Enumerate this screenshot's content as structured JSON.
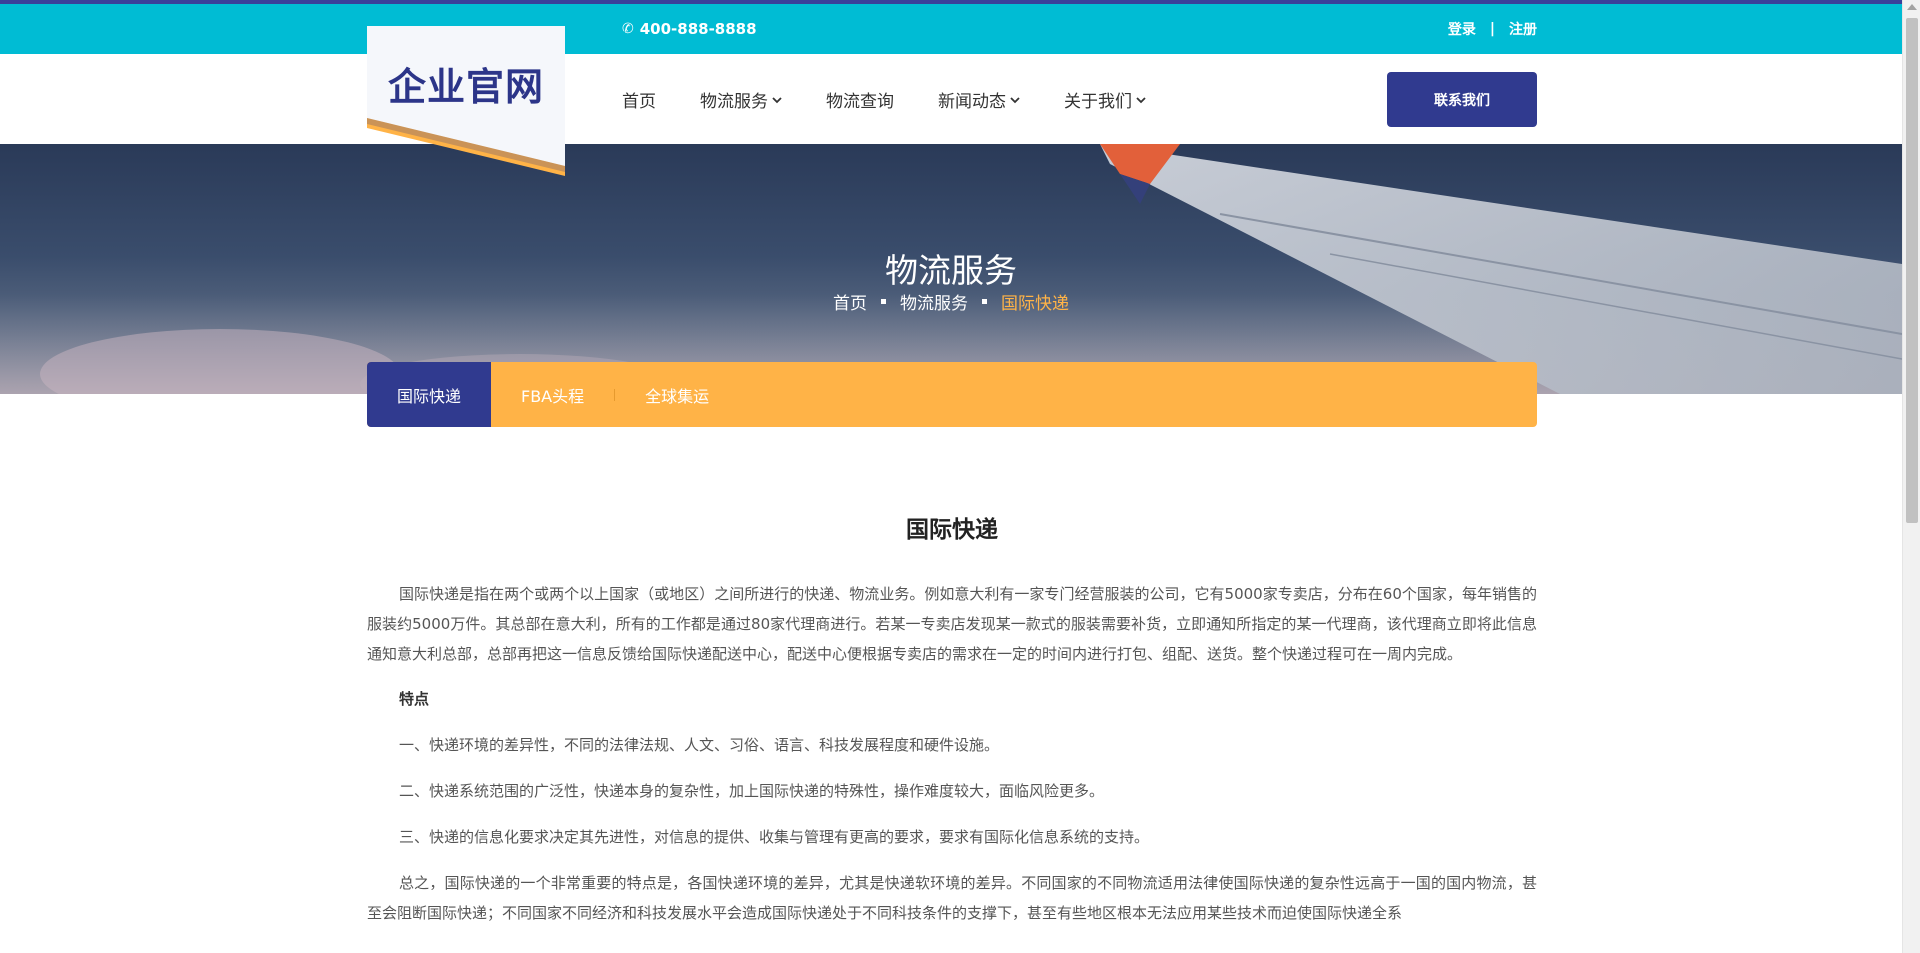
{
  "topbar": {
    "phone": "400-888-8888",
    "login": "登录",
    "divider": "|",
    "register": "注册"
  },
  "logo": {
    "text": "企业官网"
  },
  "nav": {
    "items": [
      {
        "label": "首页",
        "has_dropdown": false
      },
      {
        "label": "物流服务",
        "has_dropdown": true
      },
      {
        "label": "物流查询",
        "has_dropdown": false
      },
      {
        "label": "新闻动态",
        "has_dropdown": true
      },
      {
        "label": "关于我们",
        "has_dropdown": true
      }
    ],
    "contact_button": "联系我们"
  },
  "banner": {
    "title": "物流服务",
    "breadcrumb": [
      "首页",
      "物流服务",
      "国际快递"
    ]
  },
  "subtabs": {
    "items": [
      "国际快递",
      "FBA头程",
      "全球集运"
    ],
    "active": "国际快递"
  },
  "article": {
    "title": "国际快递",
    "intro": "国际快递是指在两个或两个以上国家（或地区）之间所进行的快递、物流业务。例如意大利有一家专门经营服装的公司，它有5000家专卖店，分布在60个国家，每年销售的服装约5000万件。其总部在意大利，所有的工作都是通过80家代理商进行。若某一专卖店发现某一款式的服装需要补货，立即通知所指定的某一代理商，该代理商立即将此信息通知意大利总部，总部再把这一信息反馈给国际快递配送中心，配送中心便根据专卖店的需求在一定的时间内进行打包、组配、送货。整个快递过程可在一周内完成。",
    "features_heading": "特点",
    "points": [
      "一、快递环境的差异性，不同的法律法规、人文、习俗、语言、科技发展程度和硬件设施。",
      "二、快递系统范围的广泛性，快递本身的复杂性，加上国际快递的特殊性，操作难度较大，面临风险更多。",
      "三、快递的信息化要求决定其先进性，对信息的提供、收集与管理有更高的要求，要求有国际化信息系统的支持。"
    ],
    "summary": "总之，国际快递的一个非常重要的特点是，各国快递环境的差异，尤其是快递软环境的差异。不同国家的不同物流适用法律使国际快递的复杂性远高于一国的国内物流，甚至会阻断国际快递；不同国家不同经济和科技发展水平会造成国际快递处于不同科技条件的支撑下，甚至有些地区根本无法应用某些技术而迫使国际快递全系"
  },
  "colors": {
    "topbar": "#00bcd4",
    "brand_navy": "#303a8f",
    "accent_orange": "#ffb347"
  }
}
